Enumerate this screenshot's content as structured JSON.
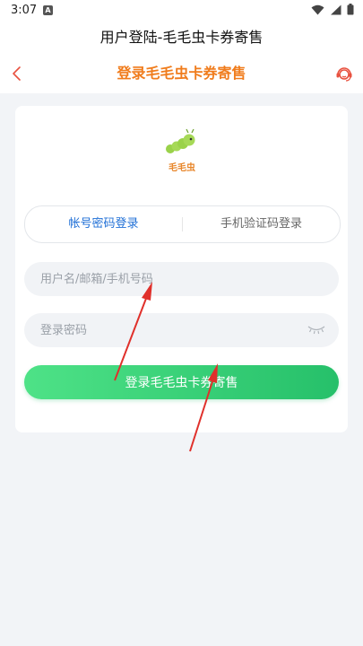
{
  "status": {
    "time": "3:07",
    "notification_letter": "A"
  },
  "window": {
    "title": "用户登陆-毛毛虫卡券寄售"
  },
  "nav": {
    "title": "登录毛毛虫卡券寄售"
  },
  "logo": {
    "text": "毛毛虫"
  },
  "tabs": [
    {
      "label": "帐号密码登录",
      "active": true
    },
    {
      "label": "手机验证码登录",
      "active": false
    }
  ],
  "form": {
    "username_placeholder": "用户名/邮箱/手机号码",
    "username_value": "",
    "password_placeholder": "登录密码",
    "password_value": "",
    "submit_label": "登录毛毛虫卡券寄售"
  },
  "colors": {
    "accent_orange": "#f07c1c",
    "tab_active": "#1f6fd6",
    "button_green": "#26c06a",
    "annotation_red": "#e0302b"
  }
}
